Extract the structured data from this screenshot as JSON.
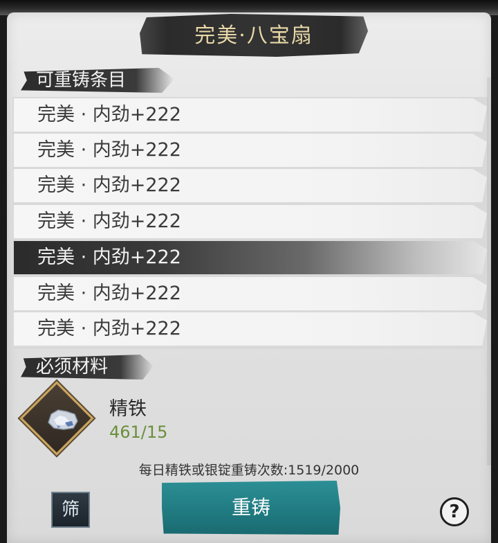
{
  "title": "完美·八宝扇",
  "sections": {
    "recastable_label": "可重铸条目",
    "required_label": "必须材料"
  },
  "recast_items": [
    {
      "label": "完美 · 内劲+222",
      "selected": false
    },
    {
      "label": "完美 · 内劲+222",
      "selected": false
    },
    {
      "label": "完美 · 内劲+222",
      "selected": false
    },
    {
      "label": "完美 · 内劲+222",
      "selected": false
    },
    {
      "label": "完美 · 内劲+222",
      "selected": true
    },
    {
      "label": "完美 · 内劲+222",
      "selected": false
    },
    {
      "label": "完美 · 内劲+222",
      "selected": false
    }
  ],
  "material": {
    "name": "精铁",
    "count": "461/15",
    "icon": "iron-ore-icon"
  },
  "daily_limit_text": "每日精铁或银锭重铸次数:1519/2000",
  "buttons": {
    "filter_label": "筛",
    "recast_label": "重铸",
    "help_label": "?"
  },
  "colors": {
    "title_text": "#e9d9a8",
    "recast_button": "#1f7a80",
    "material_count": "#6a8f3a",
    "material_frame": "#c9a35a"
  }
}
